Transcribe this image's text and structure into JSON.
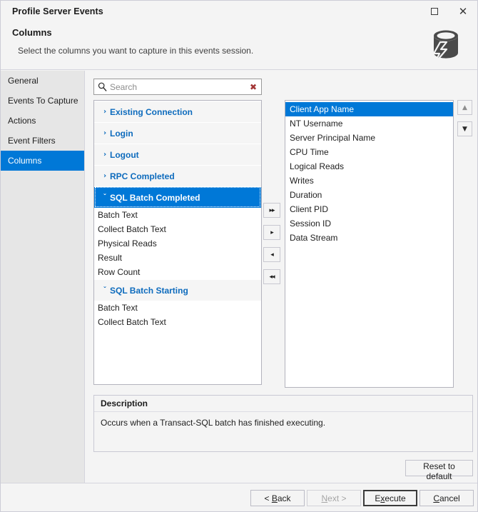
{
  "window": {
    "title": "Profile Server Events",
    "maximize_label": "Maximize",
    "close_label": "Close"
  },
  "header": {
    "title": "Columns",
    "subtitle": "Select the columns you want to capture in this events session.",
    "icon": "database-lightning-icon"
  },
  "sidebar": {
    "items": [
      {
        "label": "General",
        "active": false
      },
      {
        "label": "Events To Capture",
        "active": false
      },
      {
        "label": "Actions",
        "active": false
      },
      {
        "label": "Event Filters",
        "active": false
      },
      {
        "label": "Columns",
        "active": true
      }
    ]
  },
  "search": {
    "value": "",
    "placeholder": "Search",
    "icon": "search-icon",
    "clear_icon": "clear-x-icon",
    "clear_glyph": "✖"
  },
  "available_tree": {
    "groups": [
      {
        "label": "Existing Connection",
        "expanded": false,
        "selected": false,
        "children": []
      },
      {
        "label": "Login",
        "expanded": false,
        "selected": false,
        "children": []
      },
      {
        "label": "Logout",
        "expanded": false,
        "selected": false,
        "children": []
      },
      {
        "label": "RPC Completed",
        "expanded": false,
        "selected": false,
        "children": []
      },
      {
        "label": "SQL Batch Completed",
        "expanded": true,
        "selected": true,
        "children": [
          "Batch Text",
          "Collect Batch Text",
          "Physical Reads",
          "Result",
          "Row Count"
        ]
      },
      {
        "label": "SQL Batch Starting",
        "expanded": true,
        "selected": false,
        "children": [
          "Batch Text",
          "Collect Batch Text"
        ]
      }
    ],
    "chevron_collapsed": "›",
    "chevron_expanded": "ˇ"
  },
  "transfer_buttons": [
    {
      "name": "add-all-button",
      "glyph": "▸▸"
    },
    {
      "name": "add-button",
      "glyph": "▸"
    },
    {
      "name": "remove-button",
      "glyph": "◂"
    },
    {
      "name": "remove-all-button",
      "glyph": "◂◂"
    }
  ],
  "selected_list": {
    "items": [
      {
        "label": "Client App Name",
        "selected": true
      },
      {
        "label": "NT Username",
        "selected": false
      },
      {
        "label": "Server Principal Name",
        "selected": false
      },
      {
        "label": "CPU Time",
        "selected": false
      },
      {
        "label": "Logical Reads",
        "selected": false
      },
      {
        "label": "Writes",
        "selected": false
      },
      {
        "label": "Duration",
        "selected": false
      },
      {
        "label": "Client PID",
        "selected": false
      },
      {
        "label": "Session ID",
        "selected": false
      },
      {
        "label": "Data Stream",
        "selected": false
      }
    ]
  },
  "order_buttons": [
    {
      "name": "move-up-button",
      "glyph": "▲",
      "enabled": false
    },
    {
      "name": "move-down-button",
      "glyph": "▼",
      "enabled": true
    }
  ],
  "description": {
    "heading": "Description",
    "text": "Occurs when a Transact-SQL batch has finished executing."
  },
  "reset_button": {
    "label": "Reset to default"
  },
  "footer": {
    "back": {
      "prefix": "< ",
      "mnemonic": "B",
      "suffix": "ack",
      "disabled": false,
      "default": false
    },
    "next": {
      "prefix": "",
      "mnemonic": "N",
      "suffix": "ext >",
      "disabled": true,
      "default": false
    },
    "execute": {
      "prefix": "E",
      "mnemonic": "x",
      "suffix": "ecute",
      "disabled": false,
      "default": true
    },
    "cancel": {
      "prefix": "",
      "mnemonic": "C",
      "suffix": "ancel",
      "disabled": false,
      "default": false
    }
  },
  "colors": {
    "accent": "#0078d7",
    "group_text": "#0d6bbd",
    "clear_x": "#a33636",
    "sidebar_bg": "#e6e6e6",
    "dialog_bg": "#f4f4f4"
  }
}
